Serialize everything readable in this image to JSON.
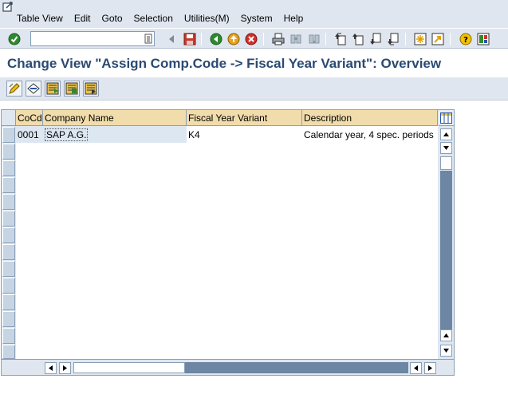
{
  "menu": {
    "items": [
      "Table View",
      "Edit",
      "Goto",
      "Selection",
      "Utilities(M)",
      "System",
      "Help"
    ]
  },
  "toolbar": {
    "command_field_value": "",
    "icons": [
      "enter-icon",
      "back-arrow-icon",
      "save-icon",
      "back-icon",
      "exit-icon",
      "cancel-icon",
      "print-icon",
      "find-icon",
      "find-next-icon",
      "first-page-icon",
      "previous-page-icon",
      "next-page-icon",
      "last-page-icon",
      "create-session-icon",
      "shortcut-icon",
      "help-icon",
      "layout-icon"
    ]
  },
  "title": "Change View \"Assign Comp.Code -> Fiscal Year Variant\": Overview",
  "app_toolbar": {
    "icons": [
      "change-display-icon",
      "select-all-icon",
      "select-block-icon",
      "deselect-all-icon",
      "details-icon"
    ]
  },
  "table": {
    "columns": [
      "CoCd",
      "Company Name",
      "Fiscal Year Variant",
      "Description"
    ],
    "rows": [
      {
        "cocd": "0001",
        "company": "SAP A.G.",
        "variant": "K4",
        "description": "Calendar year, 4 spec. periods"
      }
    ],
    "empty_rows": 13
  },
  "colors": {
    "title": "#2a4a73",
    "header": "#f1dcab",
    "toolbar_bg": "#dfe6ef"
  }
}
